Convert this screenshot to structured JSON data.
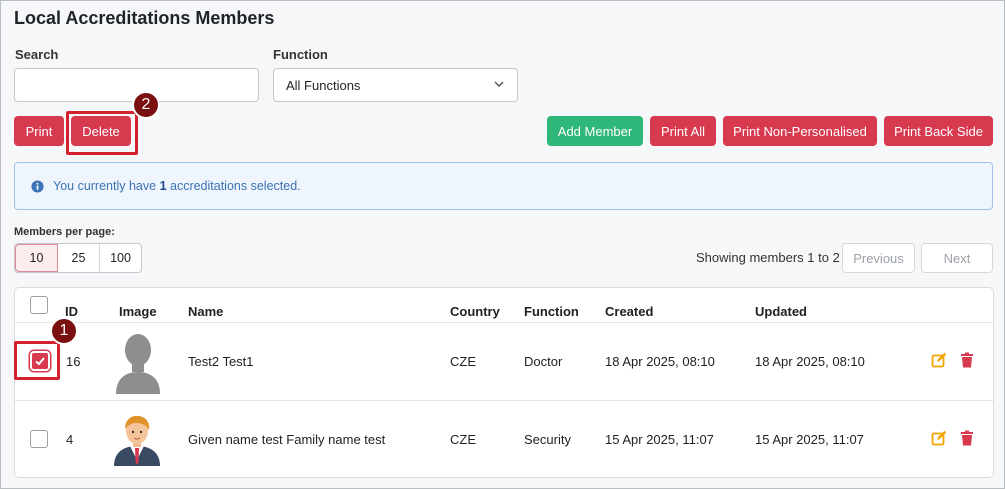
{
  "page": {
    "title": "Local Accreditations Members"
  },
  "filters": {
    "search_label": "Search",
    "search_value": "",
    "function_label": "Function",
    "function_selected": "All Functions"
  },
  "toolbar": {
    "print_label": "Print",
    "delete_label": "Delete",
    "add_member_label": "Add Member",
    "print_all_label": "Print All",
    "print_non_personalised_label": "Print Non-Personalised",
    "print_back_side_label": "Print Back Side"
  },
  "markers": {
    "one": "1",
    "two": "2"
  },
  "alert": {
    "prefix": "You currently have ",
    "count": "1",
    "suffix": " accreditations selected."
  },
  "pagination": {
    "per_page_label": "Members per page:",
    "options": [
      "10",
      "25",
      "100"
    ],
    "selected": "10",
    "showing": "Showing members 1 to 2",
    "previous": "Previous",
    "next": "Next"
  },
  "table": {
    "headers": {
      "id": "ID",
      "image": "Image",
      "name": "Name",
      "country": "Country",
      "function": "Function",
      "created": "Created",
      "updated": "Updated"
    },
    "rows": [
      {
        "checked": true,
        "id": "16",
        "image": "person-silhouette-icon",
        "name": "Test2 Test1",
        "country": "CZE",
        "function": "Doctor",
        "created": "18 Apr 2025, 08:10",
        "updated": "18 Apr 2025, 08:10"
      },
      {
        "checked": false,
        "id": "4",
        "image": "businessman-avatar-icon",
        "name": "Given name test Family name test",
        "country": "CZE",
        "function": "Security",
        "created": "15 Apr 2025, 11:07",
        "updated": "15 Apr 2025, 11:07"
      }
    ]
  },
  "colors": {
    "danger": "#d7394e",
    "success": "#2fb779",
    "info_text": "#3c73b5",
    "edit_icon": "#f0a500",
    "highlight": "#d1222e",
    "marker": "#7b1010"
  }
}
